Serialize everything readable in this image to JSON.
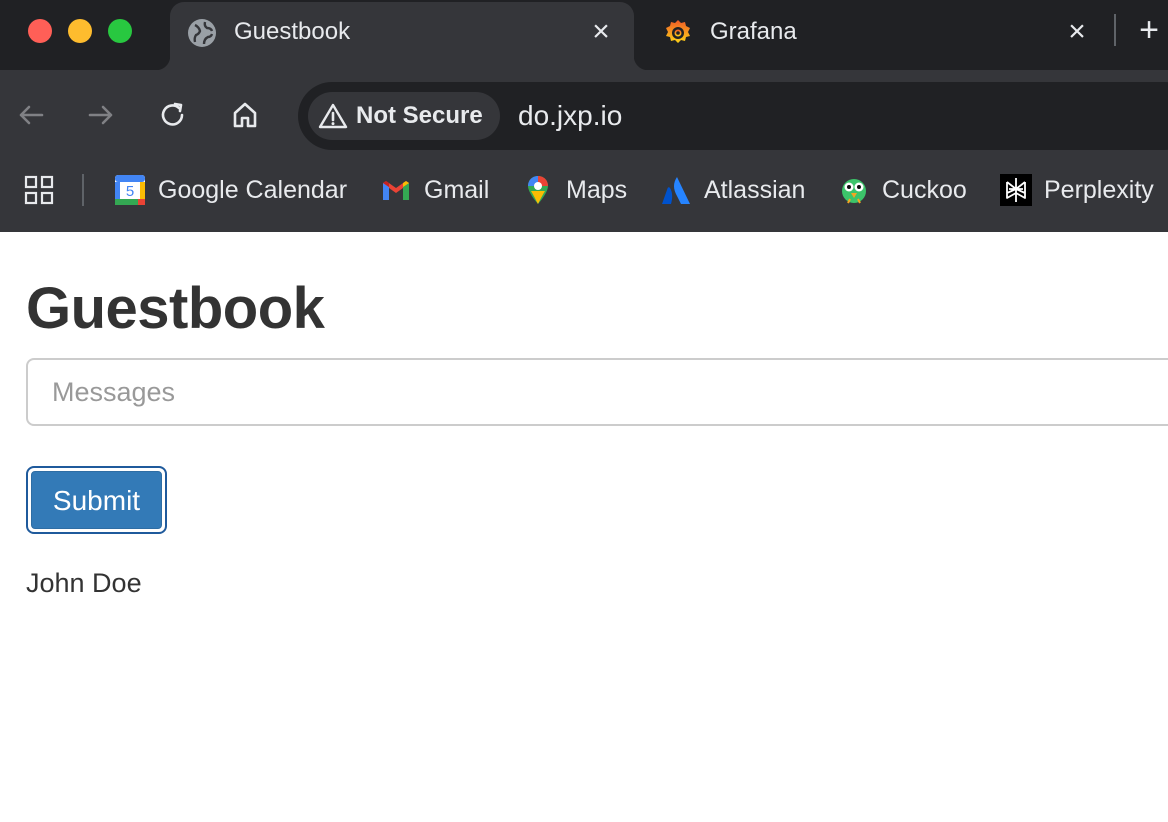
{
  "window": {
    "traffic_lights": {
      "close_color": "#ff5f57",
      "minimize_color": "#febc2e",
      "maximize_color": "#28c840"
    }
  },
  "tabs": [
    {
      "title": "Guestbook",
      "icon": "globe-icon",
      "active": true
    },
    {
      "title": "Grafana",
      "icon": "grafana-icon",
      "active": false
    }
  ],
  "toolbar": {
    "security_label": "Not Secure",
    "url": "do.jxp.io"
  },
  "bookmarks": [
    {
      "label": "Google Calendar",
      "icon": "google-calendar-icon",
      "icon_text": "5"
    },
    {
      "label": "Gmail",
      "icon": "gmail-icon"
    },
    {
      "label": "Maps",
      "icon": "maps-icon"
    },
    {
      "label": "Atlassian",
      "icon": "atlassian-icon"
    },
    {
      "label": "Cuckoo",
      "icon": "cuckoo-icon"
    },
    {
      "label": "Perplexity",
      "icon": "perplexity-icon"
    }
  ],
  "page": {
    "title": "Guestbook",
    "message_placeholder": "Messages",
    "message_value": "",
    "submit_label": "Submit",
    "entries": [
      "John Doe"
    ]
  },
  "colors": {
    "tabstrip": "#202124",
    "toolbar": "#35363a",
    "accent_button": "#337ab7",
    "heading_text": "#333333"
  }
}
